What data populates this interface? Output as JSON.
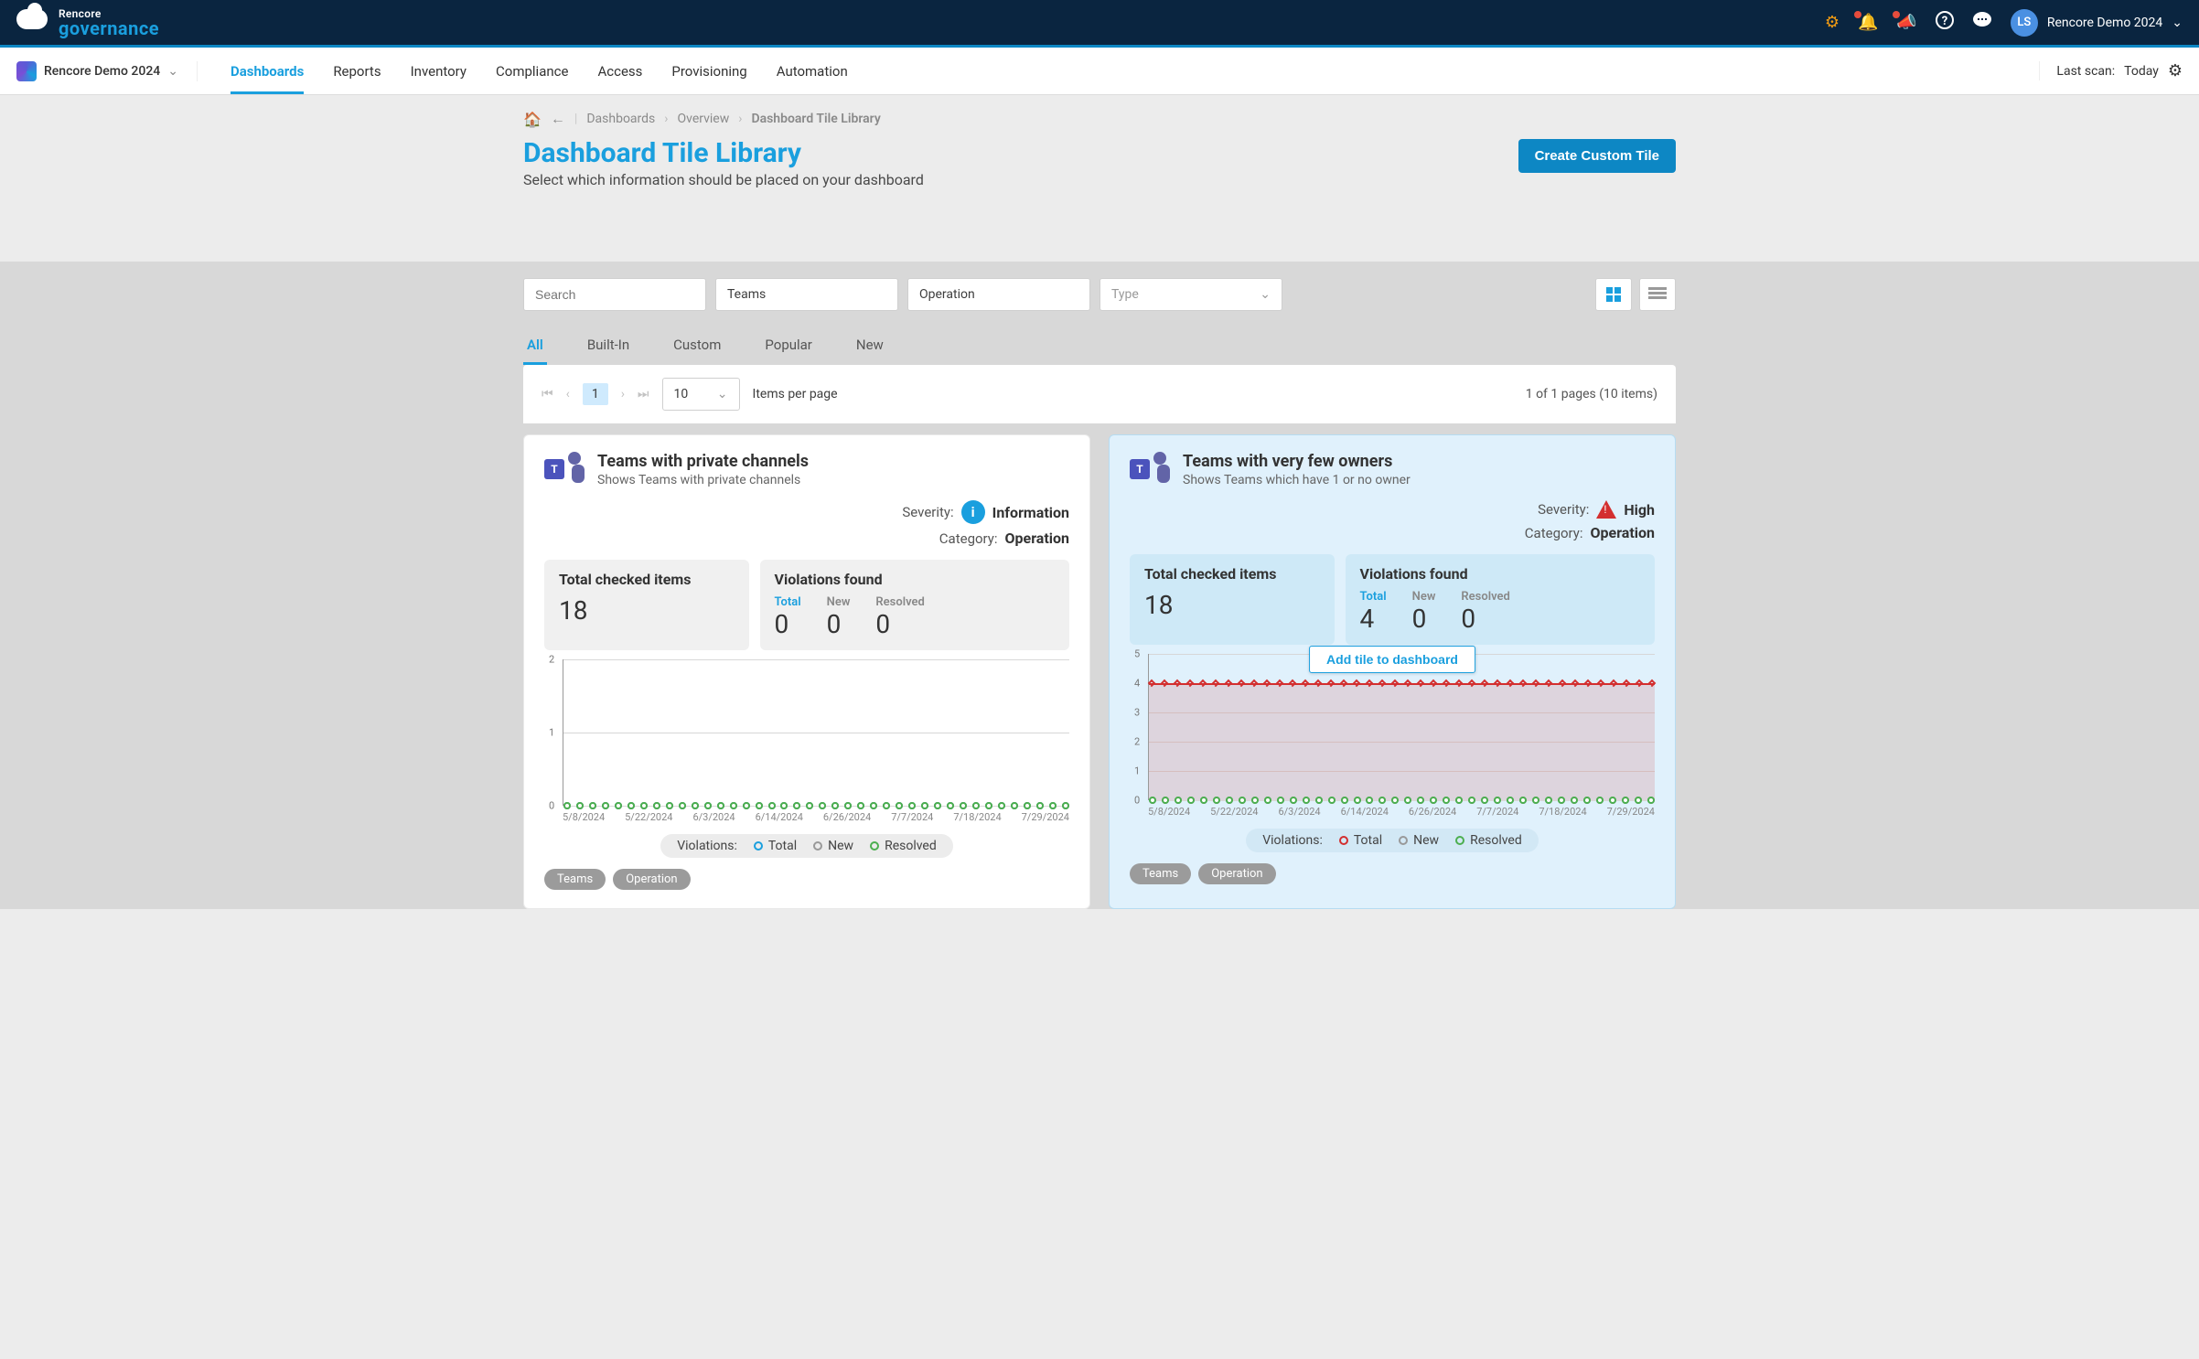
{
  "brand": {
    "line1": "Rencore",
    "line2": "governance"
  },
  "user": {
    "initials": "LS",
    "label": "Rencore Demo 2024"
  },
  "org": {
    "name": "Rencore Demo 2024"
  },
  "nav": {
    "tabs": [
      "Dashboards",
      "Reports",
      "Inventory",
      "Compliance",
      "Access",
      "Provisioning",
      "Automation"
    ]
  },
  "lastscan": {
    "label": "Last scan:",
    "value": "Today"
  },
  "breadcrumb": {
    "items": [
      "Dashboards",
      "Overview",
      "Dashboard Tile Library"
    ]
  },
  "page": {
    "title": "Dashboard Tile Library",
    "subtitle": "Select which information should be placed on your dashboard"
  },
  "buttons": {
    "create": "Create Custom Tile",
    "add": "Add tile to dashboard"
  },
  "filters": {
    "search_placeholder": "Search",
    "workload": "Teams",
    "category": "Operation",
    "type_placeholder": "Type"
  },
  "subtabs": [
    "All",
    "Built-In",
    "Custom",
    "Popular",
    "New"
  ],
  "pager": {
    "page": "1",
    "size": "10",
    "per_label": "Items per page",
    "info": "1 of 1 pages (10 items)"
  },
  "legend": {
    "label": "Violations:",
    "total": "Total",
    "new": "New",
    "resolved": "Resolved"
  },
  "tags": {
    "teams": "Teams",
    "operation": "Operation"
  },
  "labels": {
    "severity": "Severity:",
    "category": "Category:",
    "checked": "Total checked items",
    "violations": "Violations found",
    "v_total": "Total",
    "v_new": "New",
    "v_resolved": "Resolved"
  },
  "severity": {
    "info": "Information",
    "high": "High"
  },
  "category_val": "Operation",
  "cards": [
    {
      "title": "Teams with private channels",
      "sub": "Shows Teams with private channels",
      "sev": "info",
      "checked": "18",
      "violations": {
        "total": "0",
        "new": "0",
        "resolved": "0"
      }
    },
    {
      "title": "Teams with very few owners",
      "sub": "Shows Teams which have 1 or no owner",
      "sev": "high",
      "checked": "18",
      "violations": {
        "total": "4",
        "new": "0",
        "resolved": "0"
      }
    }
  ],
  "chart_data": [
    {
      "type": "line",
      "categories": [
        "5/8/2024",
        "5/22/2024",
        "6/3/2024",
        "6/14/2024",
        "6/26/2024",
        "7/7/2024",
        "7/18/2024",
        "7/29/2024"
      ],
      "ylim": [
        0,
        2
      ],
      "yticks": [
        0,
        1,
        2
      ],
      "series": [
        {
          "name": "Total",
          "color": "#1a9fde",
          "value_constant": 0
        },
        {
          "name": "New",
          "color": "#999999",
          "value_constant": 0
        },
        {
          "name": "Resolved",
          "color": "#4caf50",
          "value_constant": 0
        }
      ]
    },
    {
      "type": "area",
      "categories": [
        "5/8/2024",
        "5/22/2024",
        "6/3/2024",
        "6/14/2024",
        "6/26/2024",
        "7/7/2024",
        "7/18/2024",
        "7/29/2024"
      ],
      "ylim": [
        0,
        5
      ],
      "yticks": [
        0,
        1,
        2,
        3,
        4,
        5
      ],
      "series": [
        {
          "name": "Total",
          "color": "#d32f2f",
          "value_constant": 4
        },
        {
          "name": "New",
          "color": "#999999",
          "value_constant": 0
        },
        {
          "name": "Resolved",
          "color": "#4caf50",
          "value_constant": 0
        }
      ]
    }
  ]
}
